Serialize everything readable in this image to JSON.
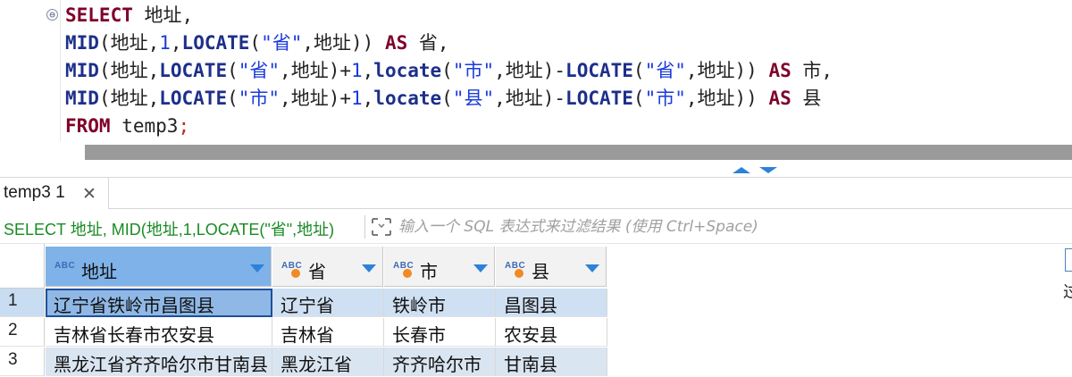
{
  "editor": {
    "fold_glyph": "⊖",
    "lines": [
      [
        {
          "t": "SELECT",
          "c": "kw"
        },
        {
          "t": " 地址,",
          "c": "id"
        }
      ],
      [
        {
          "t": "MID",
          "c": "fn"
        },
        {
          "t": "(地址,",
          "c": "id"
        },
        {
          "t": "1",
          "c": "num"
        },
        {
          "t": ",",
          "c": "id"
        },
        {
          "t": "LOCATE",
          "c": "fn"
        },
        {
          "t": "(",
          "c": "id"
        },
        {
          "t": "\"省\"",
          "c": "str"
        },
        {
          "t": ",地址)) ",
          "c": "id"
        },
        {
          "t": "AS",
          "c": "kw"
        },
        {
          "t": " 省,",
          "c": "id"
        }
      ],
      [
        {
          "t": "MID",
          "c": "fn"
        },
        {
          "t": "(地址,",
          "c": "id"
        },
        {
          "t": "LOCATE",
          "c": "fn"
        },
        {
          "t": "(",
          "c": "id"
        },
        {
          "t": "\"省\"",
          "c": "str"
        },
        {
          "t": ",地址)+",
          "c": "id"
        },
        {
          "t": "1",
          "c": "num"
        },
        {
          "t": ",",
          "c": "id"
        },
        {
          "t": "locate",
          "c": "fn"
        },
        {
          "t": "(",
          "c": "id"
        },
        {
          "t": "\"市\"",
          "c": "str"
        },
        {
          "t": ",地址)-",
          "c": "id"
        },
        {
          "t": "LOCATE",
          "c": "fn"
        },
        {
          "t": "(",
          "c": "id"
        },
        {
          "t": "\"省\"",
          "c": "str"
        },
        {
          "t": ",地址)) ",
          "c": "id"
        },
        {
          "t": "AS",
          "c": "kw"
        },
        {
          "t": " 市,",
          "c": "id"
        }
      ],
      [
        {
          "t": "MID",
          "c": "fn"
        },
        {
          "t": "(地址,",
          "c": "id"
        },
        {
          "t": "LOCATE",
          "c": "fn"
        },
        {
          "t": "(",
          "c": "id"
        },
        {
          "t": "\"市\"",
          "c": "str"
        },
        {
          "t": ",地址)+",
          "c": "id"
        },
        {
          "t": "1",
          "c": "num"
        },
        {
          "t": ",",
          "c": "id"
        },
        {
          "t": "locate",
          "c": "fn"
        },
        {
          "t": "(",
          "c": "id"
        },
        {
          "t": "\"县\"",
          "c": "str"
        },
        {
          "t": ",地址)-",
          "c": "id"
        },
        {
          "t": "LOCATE",
          "c": "fn"
        },
        {
          "t": "(",
          "c": "id"
        },
        {
          "t": "\"市\"",
          "c": "str"
        },
        {
          "t": ",地址)) ",
          "c": "id"
        },
        {
          "t": "AS",
          "c": "kw"
        },
        {
          "t": " 县",
          "c": "id"
        }
      ],
      [
        {
          "t": "FROM",
          "c": "kw"
        },
        {
          "t": " temp3",
          "c": "id"
        },
        {
          "t": ";",
          "c": "semi"
        }
      ]
    ]
  },
  "results_tab": {
    "label": "temp3 1",
    "close_glyph": "✕"
  },
  "filter": {
    "sql_preview": "SELECT 地址, MID(地址,1,LOCATE(\"省\",地址)",
    "placeholder": "输入一个 SQL 表达式来过滤结果 (使用 Ctrl+Space)"
  },
  "grid": {
    "type_badge": "ABC",
    "columns": [
      "地址",
      "省",
      "市",
      "县"
    ],
    "rows": [
      {
        "num": "1",
        "cells": [
          "辽宁省铁岭市昌图县",
          "辽宁省",
          "铁岭市",
          "昌图县"
        ]
      },
      {
        "num": "2",
        "cells": [
          "吉林省长春市农安县",
          "吉林省",
          "长春市",
          "农安县"
        ]
      },
      {
        "num": "3",
        "cells": [
          "黑龙江省齐齐哈尔市甘南县",
          "黑龙江省",
          "齐齐哈尔市",
          "甘南县"
        ]
      }
    ],
    "right_edge_glyph": "过"
  },
  "colors": {
    "keyword": "#7f0029",
    "function": "#1d2f8a",
    "literal": "#1a3bdc",
    "filter_sql": "#1a8b24",
    "selected_header": "#7fb2e8",
    "sort_icon": "#2c82d8"
  }
}
